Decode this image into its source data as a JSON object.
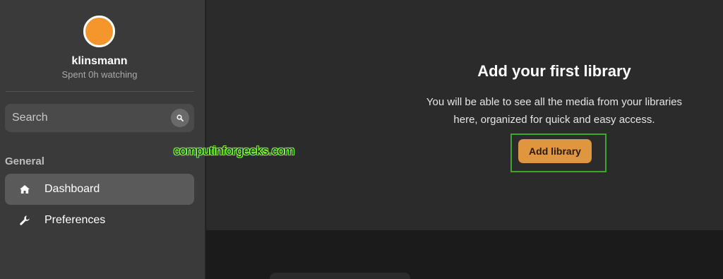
{
  "user": {
    "name": "klinsmann",
    "watch_time": "Spent 0h watching"
  },
  "sidebar": {
    "search_placeholder": "Search",
    "section_label": "General",
    "items": [
      {
        "label": "Dashboard",
        "icon": "home-icon",
        "active": true
      },
      {
        "label": "Preferences",
        "icon": "wrench-icon",
        "active": false
      }
    ]
  },
  "main": {
    "title": "Add your first library",
    "description_line1": "You will be able to see all the media from your libraries",
    "description_line2": "here, organized for quick and easy access.",
    "add_library_label": "Add library"
  },
  "watermark": "computinforgeeks.com",
  "colors": {
    "accent": "#e0953f",
    "avatar": "#f4962b",
    "sidebar_bg": "#3a3a3a",
    "main_bg": "#2b2b2b",
    "highlight": "#3fa52c"
  }
}
